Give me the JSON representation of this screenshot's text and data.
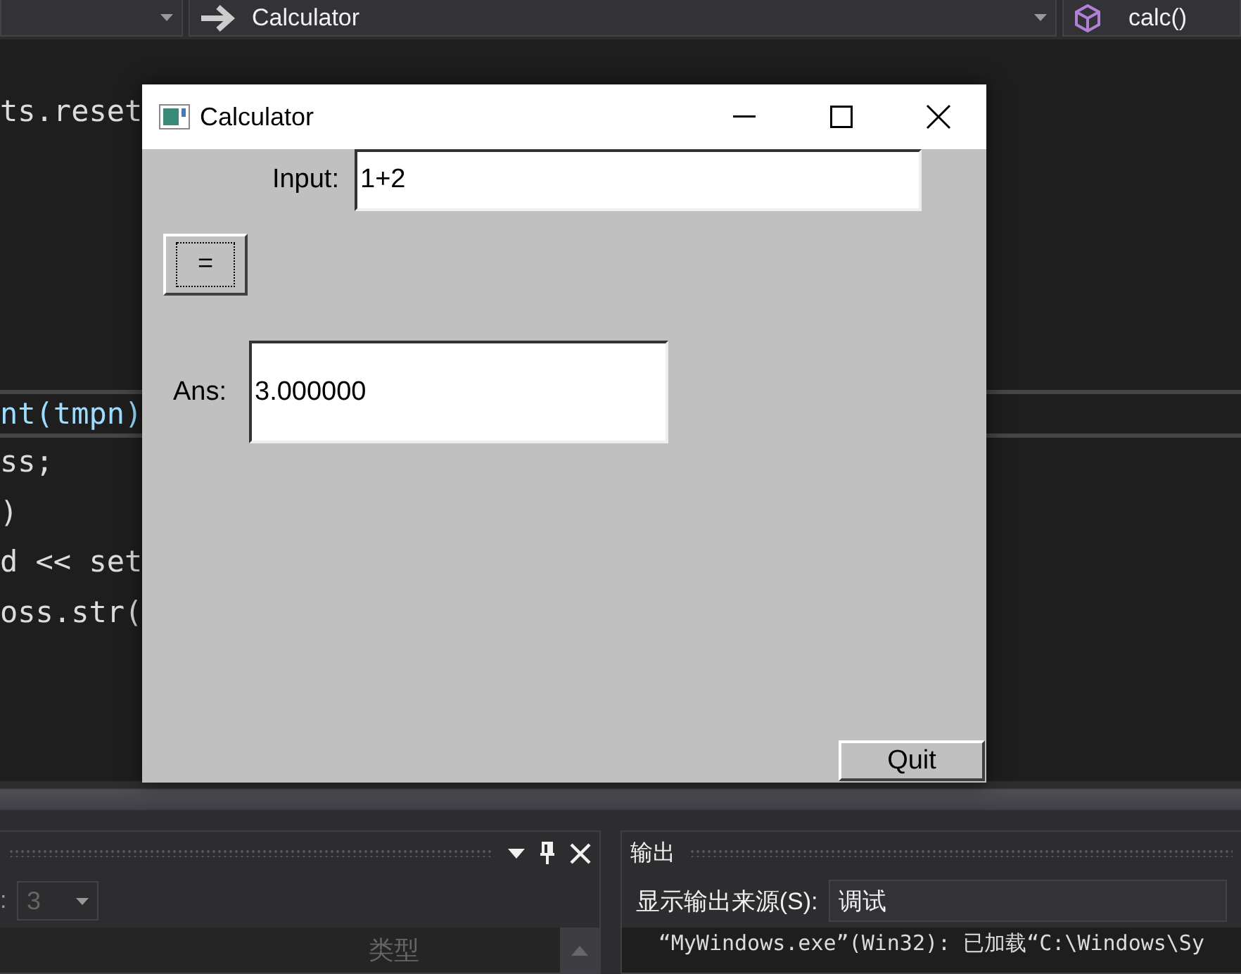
{
  "toolbar": {
    "type": "Calculator",
    "member": "calc()"
  },
  "editor": {
    "blocks": [
      [
        {
          "text": "ts.reset",
          "current": false
        }
      ],
      [
        {
          "text": "nt(tmpn)",
          "current": true
        },
        {
          "text": "ss;",
          "current": false
        },
        {
          "text": ")",
          "current": false
        },
        {
          "text": "d << set",
          "current": false
        },
        {
          "text": "oss.str(",
          "current": false
        }
      ]
    ]
  },
  "calculator": {
    "title": "Calculator",
    "input_label": "Input:",
    "input": "1+2",
    "equals": {
      "label": "=",
      "focused": true
    },
    "ans_label": "Ans:",
    "ans": "3.000000",
    "quit": "Quit"
  },
  "left_panel": {
    "field_label": ":",
    "count": {
      "value": "3",
      "disabled": true
    },
    "column": "类型"
  },
  "output_panel": {
    "title": "输出",
    "source_label": "显示输出来源(S):",
    "source": "调试",
    "lines": [
      "“MyWindows.exe”(Win32): 已加载“C:\\Windows\\Sy"
    ]
  }
}
